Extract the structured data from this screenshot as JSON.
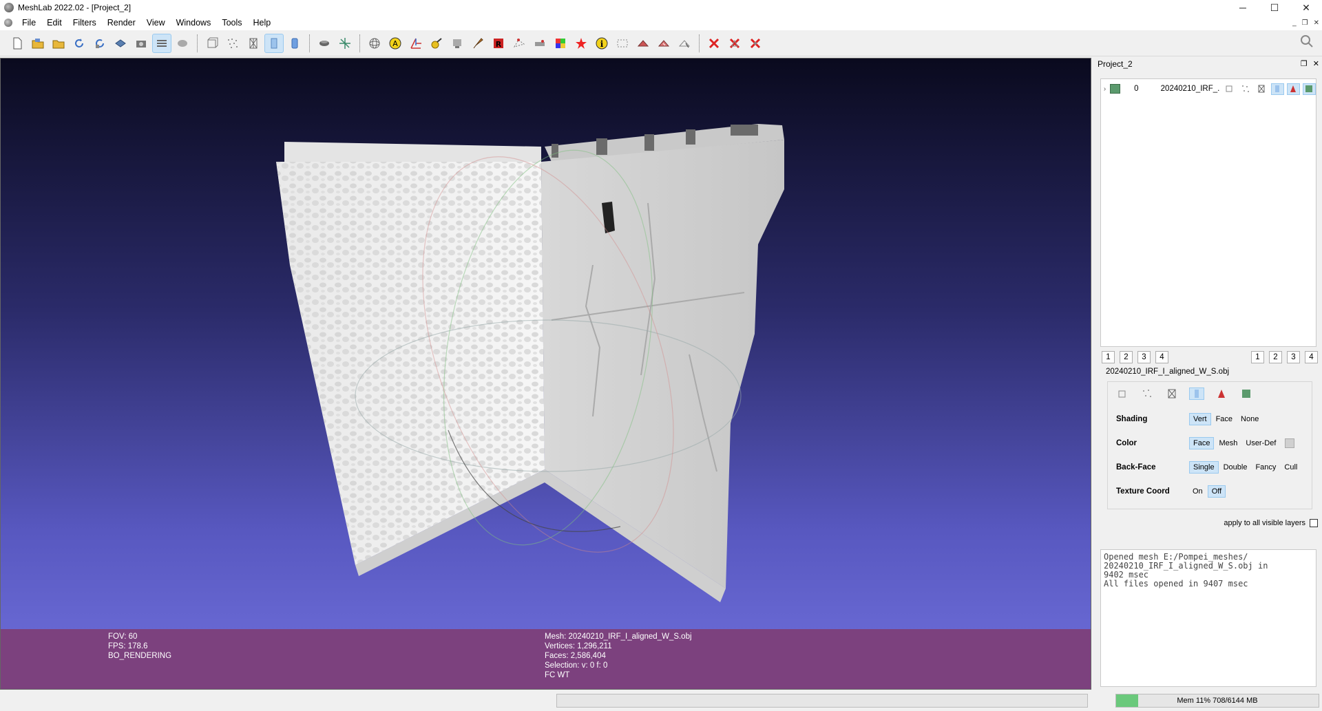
{
  "window": {
    "title": "MeshLab 2022.02 - [Project_2]",
    "controls": {
      "minimize": "─",
      "maximize": "☐",
      "close": "✕"
    }
  },
  "menu": {
    "items": [
      "File",
      "Edit",
      "Filters",
      "Render",
      "View",
      "Windows",
      "Tools",
      "Help"
    ],
    "mdi_controls": [
      "_",
      "❐",
      "✕"
    ]
  },
  "toolbar": {
    "icons": [
      "new-project-icon",
      "open-project-icon",
      "open-mesh-icon",
      "reload-icon",
      "reload-all-icon",
      "save-icon",
      "snapshot-icon",
      "layers-icon",
      "layers-split-icon",
      "bbox-icon",
      "points-icon",
      "wireframe-icon",
      "flat-icon",
      "smooth-icon",
      "light-icon",
      "axis-icon",
      "trackball-icon",
      "annotation-icon",
      "align-icon",
      "paint-icon",
      "measure-icon",
      "brush-icon",
      "texture-icon",
      "select-vertex-icon",
      "select-connected-icon",
      "color-icon",
      "georef-icon",
      "info-icon",
      "select-area-icon",
      "select-faces-icon",
      "select-rect-icon",
      "select-rect2-icon",
      "delete-icon",
      "delete-faces-icon",
      "delete-vertices-icon"
    ]
  },
  "viewport": {
    "info_left": [
      "FOV: 60",
      "FPS:   178.6",
      "BO_RENDERING"
    ],
    "info_right": [
      "Mesh: 20240210_IRF_I_aligned_W_S.obj",
      "Vertices: 1,296,211",
      "Faces: 2,586,404",
      "Selection: v: 0 f: 0",
      "FC WT"
    ]
  },
  "panel": {
    "project_title": "Project_2",
    "header_controls": [
      "❐",
      "✕"
    ],
    "layer": {
      "index": "0",
      "name": "20240210_IRF_..."
    },
    "view_tabs_left": [
      "1",
      "2",
      "3",
      "4"
    ],
    "view_tabs_right": [
      "1",
      "2",
      "3",
      "4"
    ],
    "mesh_name": "20240210_IRF_I_aligned_W_S.obj",
    "render_props": [
      {
        "label": "Shading",
        "options": [
          "Vert",
          "Face",
          "None"
        ],
        "selected": 0
      },
      {
        "label": "Color",
        "options": [
          "Face",
          "Mesh",
          "User-Def"
        ],
        "selected": 0
      },
      {
        "label": "Back-Face",
        "options": [
          "Single",
          "Double",
          "Fancy",
          "Cull"
        ],
        "selected": 0
      },
      {
        "label": "Texture Coord",
        "options": [
          "On",
          "Off"
        ],
        "selected": 1
      }
    ],
    "apply_all_label": "apply to all visible layers",
    "log": [
      "Opened mesh E:/Pompei_meshes/",
      "20240210_IRF_I_aligned_W_S.obj in",
      "9402 msec",
      "All files opened in 9407 msec"
    ]
  },
  "status": {
    "memory_text": "Mem 11% 708/6144 MB",
    "memory_fraction": 0.11
  },
  "colors": {
    "info_bar": "#7c417e",
    "accent": "#cde4f7"
  }
}
